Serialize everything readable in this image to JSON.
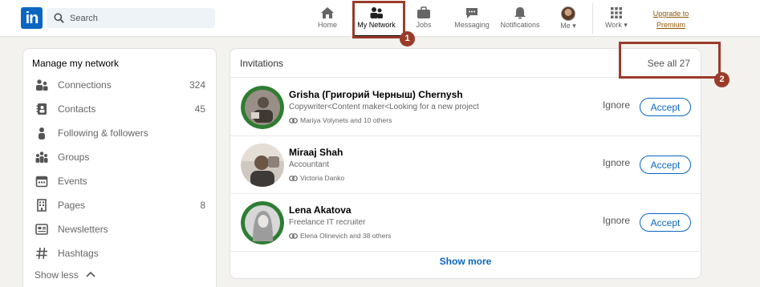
{
  "nav": {
    "logo_text": "in",
    "search_placeholder": "Search",
    "items": [
      {
        "label": "Home",
        "icon": "home-icon"
      },
      {
        "label": "My Network",
        "icon": "my-network-icon"
      },
      {
        "label": "Jobs",
        "icon": "jobs-icon"
      },
      {
        "label": "Messaging",
        "icon": "messaging-icon"
      },
      {
        "label": "Notifications",
        "icon": "notifications-icon"
      },
      {
        "label": "Me",
        "icon": "avatar"
      },
      {
        "label": "Work",
        "icon": "grid-icon"
      }
    ],
    "premium_line1": "Upgrade to",
    "premium_line2": "Premium"
  },
  "annotations": {
    "one": "1",
    "two": "2"
  },
  "left": {
    "title": "Manage my network",
    "items": [
      {
        "label": "Connections",
        "count": "324",
        "icon": "connections-icon"
      },
      {
        "label": "Contacts",
        "count": "45",
        "icon": "contacts-icon"
      },
      {
        "label": "Following & followers",
        "count": "",
        "icon": "person-icon"
      },
      {
        "label": "Groups",
        "count": "",
        "icon": "groups-icon"
      },
      {
        "label": "Events",
        "count": "",
        "icon": "calendar-icon"
      },
      {
        "label": "Pages",
        "count": "8",
        "icon": "building-icon"
      },
      {
        "label": "Newsletters",
        "count": "",
        "icon": "newsletter-icon"
      },
      {
        "label": "Hashtags",
        "count": "",
        "icon": "hashtag-icon"
      }
    ],
    "show_less": "Show less"
  },
  "invitations": {
    "title": "Invitations",
    "see_all": "See all 27",
    "ignore_label": "Ignore",
    "accept_label": "Accept",
    "show_more": "Show more",
    "rows": [
      {
        "name": "Grisha (Григорий Черныш) Chernysh",
        "headline": "Copywriter<Content maker<Looking for a new project",
        "mutual": "Mariya Volynets and 10 others"
      },
      {
        "name": "Miraaj Shah",
        "headline": "Accountant",
        "mutual": "Victoria Danko"
      },
      {
        "name": "Lena Akatova",
        "headline": "Freelance IT recruiter",
        "mutual": "Elena Olinevich and 38 others"
      }
    ]
  },
  "colors": {
    "accent": "#0a66c2",
    "annotation": "#9a3b2a",
    "premium": "#915907"
  }
}
